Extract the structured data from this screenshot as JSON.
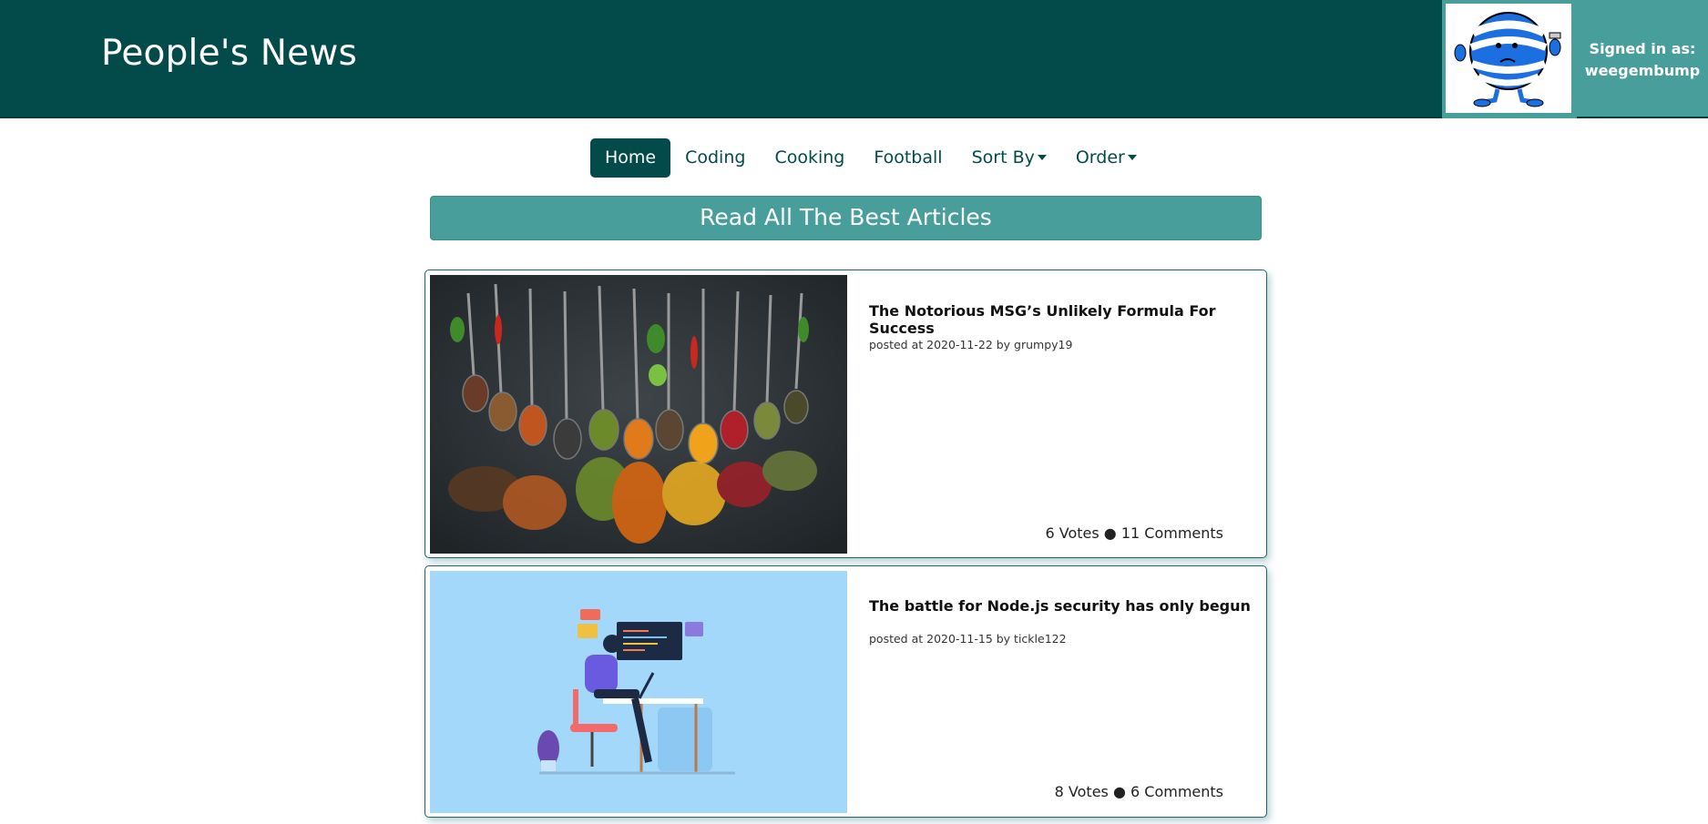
{
  "header": {
    "site_title": "People's News",
    "signed_in_label": "Signed in as:",
    "username": "weegembump"
  },
  "nav": {
    "home": "Home",
    "coding": "Coding",
    "cooking": "Cooking",
    "football": "Football",
    "sort_by": "Sort By",
    "order": "Order"
  },
  "banner": {
    "text": "Read All The Best Articles"
  },
  "articles": [
    {
      "title": "The Notorious MSG’s Unlikely Formula For Success",
      "meta": "posted at 2020-11-22 by grumpy19",
      "stats": "6 Votes ● 11 Comments"
    },
    {
      "title": "The battle for Node.js security has only begun",
      "meta": "posted at 2020-11-15 by tickle122",
      "stats": "8 Votes ● 6 Comments"
    }
  ],
  "colors": {
    "header_bg": "#034a4a",
    "accent": "#489e9a",
    "card_border": "#1d6664"
  }
}
